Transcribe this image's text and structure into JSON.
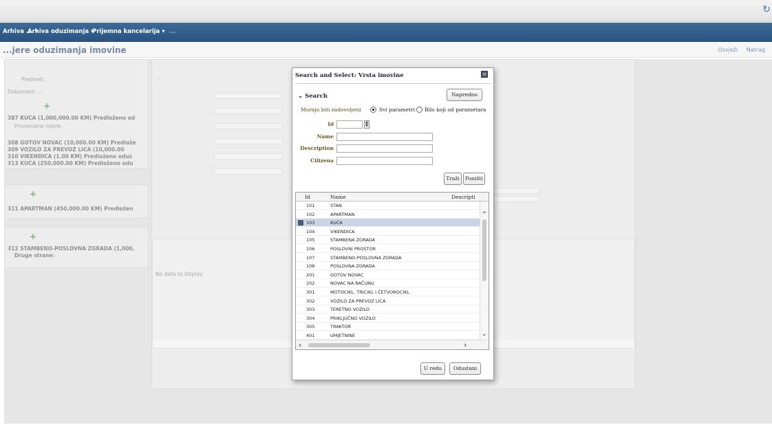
{
  "nav": {
    "items": [
      "Arhiva ... ▾",
      "Arhiva oduzimanja ▾",
      "Prijemna kancelarija ▾",
      "..."
    ]
  },
  "page": {
    "title": "...jere oduzimanja imovine",
    "actions": [
      "Osvježi",
      "Natrag"
    ]
  },
  "dialog": {
    "title": "Search and Select: Vrsta imovine",
    "close_icon": "close-icon",
    "search_label": "Search",
    "advanced_button": "Napredno",
    "match_label": "Moraju biti zadovoljeni",
    "match_options": [
      "Svi parametri",
      "Bilo koji od parametara"
    ],
    "match_selected": 0,
    "fields": {
      "id_label": "Id",
      "name_label": "Name",
      "description_label": "Description",
      "citizen_label": "Cilizena"
    },
    "search_button": "Traži",
    "reset_button": "Poništi",
    "table": {
      "columns": [
        "Id",
        "Name",
        "Descripti"
      ],
      "rows": [
        {
          "id": "101",
          "name": "STAN"
        },
        {
          "id": "102",
          "name": "APARTMAN"
        },
        {
          "id": "103",
          "name": "KUĆA"
        },
        {
          "id": "104",
          "name": "VIKENDICA"
        },
        {
          "id": "105",
          "name": "STAMBENA ZGRADA"
        },
        {
          "id": "106",
          "name": "POSLOVNI PROSTOR"
        },
        {
          "id": "107",
          "name": "STAMBENO-POSLOVNA ZGRADA"
        },
        {
          "id": "108",
          "name": "POSLOVNA ZGRADA"
        },
        {
          "id": "201",
          "name": "GOTOV NOVAC"
        },
        {
          "id": "202",
          "name": "NOVAC NA RAČUNU"
        },
        {
          "id": "301",
          "name": "MOTOCIKL, TRICIKL I ČETVOROCIKL"
        },
        {
          "id": "302",
          "name": "VOZILO ZA PREVOZ LICA"
        },
        {
          "id": "303",
          "name": "TERETNO VOZILO"
        },
        {
          "id": "304",
          "name": "PRIKLJUČNO VOZILO"
        },
        {
          "id": "305",
          "name": "TRAKTOR"
        },
        {
          "id": "401",
          "name": "UMJETNINE"
        }
      ],
      "selected_row": 2
    },
    "ok_button": "U redu",
    "cancel_button": "Odustani"
  },
  "background": {
    "lines": [
      "387 KUĆA (1,000,000.00 KM) Predloženo od",
      "Privremene mjere:",
      "308 GOTOV NOVAC (10,000.00 KM) Predlože",
      "309 VOZILO ZA PREVOZ LICA (10,000.00",
      "310 VIKENDICA (1.00 KM) Predloženo oduz",
      "313 KUĆA (250,000.00 KM) Predloženo odu",
      "311 APARTMAN (450,000.00 KM) Predložen",
      "312 STAMBENO-POSLOVNA ZGRADA (1,000,",
      "Druge strane:",
      "No data to display"
    ]
  }
}
